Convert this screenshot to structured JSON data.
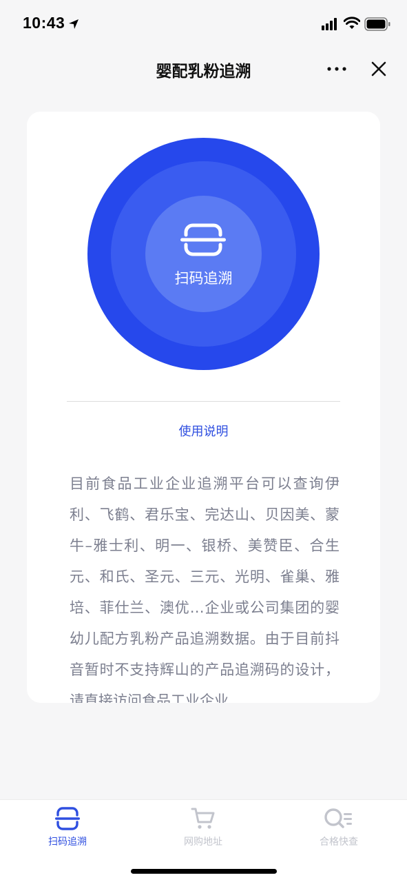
{
  "status_bar": {
    "time": "10:43"
  },
  "nav": {
    "title": "婴配乳粉追溯"
  },
  "scan": {
    "label": "扫码追溯"
  },
  "instructions": {
    "link_label": "使用说明"
  },
  "description": "目前食品工业企业追溯平台可以查询伊利、飞鹤、君乐宝、完达山、贝因美、蒙牛–雅士利、明一、银桥、美赞臣、合生元、和氏、圣元、三元、光明、雀巢、雅培、菲仕兰、澳优…企业或公司集团的婴幼儿配方乳粉产品追溯数据。由于目前抖音暂时不支持辉山的产品追溯码的设计，请直接访问食品工业企业",
  "tabs": [
    {
      "label": "扫码追溯",
      "icon": "scan-icon",
      "active": true
    },
    {
      "label": "网购地址",
      "icon": "cart-icon",
      "active": false
    },
    {
      "label": "合格快查",
      "icon": "search-list-icon",
      "active": false
    }
  ],
  "colors": {
    "accent": "#2f4fe0",
    "circle_outer": "#2648ec",
    "circle_mid": "#3a5cf0",
    "circle_inner": "#5b7bf3"
  }
}
